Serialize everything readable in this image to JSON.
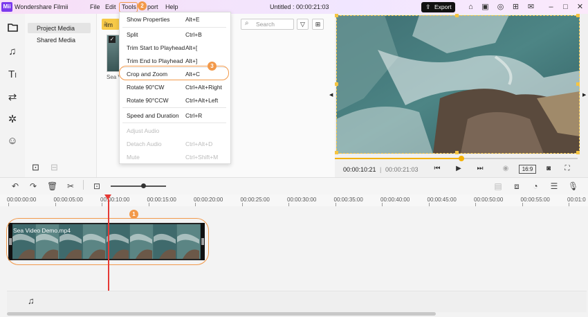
{
  "app": {
    "logo": "Mii",
    "name": "Wondershare Filmii"
  },
  "menubar": [
    "File",
    "Edit",
    "Tools",
    "Export",
    "Help"
  ],
  "menubar_visible": {
    "file": "File",
    "edit": "Edit",
    "tools": "Tools",
    "export_partial": "port",
    "help": "Help"
  },
  "doc_title": "Untitled :  00:00:21:03",
  "export_button": "Export",
  "export_icon": "export-icon",
  "title_icons": [
    "home-icon",
    "save-icon",
    "account-icon",
    "gift-icon",
    "minimize-icon",
    "maximize-icon",
    "close-icon"
  ],
  "left_rail": [
    "media-folder-icon",
    "audio-icon",
    "text-icon",
    "transition-icon",
    "effects-icon",
    "sticker-icon"
  ],
  "media_categories": {
    "project": "Project Media",
    "shared": "Shared Media"
  },
  "media_panel": {
    "import_label": "Im",
    "thumb_label": "Sea V",
    "search_placeholder": "Search"
  },
  "tools_menu": {
    "items": [
      {
        "label": "Show Properties",
        "shortcut": "Alt+E",
        "enabled": true
      },
      {
        "label": "Split",
        "shortcut": "Ctrl+B",
        "enabled": true
      },
      {
        "label": "Trim Start to Playhead",
        "shortcut": "Alt+[",
        "enabled": true
      },
      {
        "label": "Trim End to Playhead",
        "shortcut": "Alt+]",
        "enabled": true
      },
      {
        "label": "Crop and Zoom",
        "shortcut": "Alt+C",
        "enabled": true
      },
      {
        "label": "Rotate 90°CW",
        "shortcut": "Ctrl+Alt+Right",
        "enabled": true
      },
      {
        "label": "Rotate 90°CCW",
        "shortcut": "Ctrl+Alt+Left",
        "enabled": true
      },
      {
        "label": "Speed and Duration",
        "shortcut": "Ctrl+R",
        "enabled": true
      },
      {
        "label": "Adjust Audio",
        "shortcut": "",
        "enabled": false
      },
      {
        "label": "Detach Audio",
        "shortcut": "Ctrl+Alt+D",
        "enabled": false
      },
      {
        "label": "Mute",
        "shortcut": "Ctrl+Shift+M",
        "enabled": false
      }
    ]
  },
  "step_badges": {
    "timeline_clip": "1",
    "tools_menu": "2",
    "crop_and_zoom": "3"
  },
  "preview": {
    "current_time": "00:00:10:21",
    "separator": "|",
    "total_time": "00:00:21:03",
    "progress": 0.52,
    "aspect_ratio": "16:9"
  },
  "timeline": {
    "ruler": [
      "00:00:00:00",
      "00:00:05:00",
      "00:00:10:00",
      "00:00:15:00",
      "00:00:20:00",
      "00:00:25:00",
      "00:00:30:00",
      "00:00:35:00",
      "00:00:40:00",
      "00:00:45:00",
      "00:00:50:00",
      "00:00:55:00",
      "00:01:0"
    ],
    "clip_name": "Sea Video Demo.mp4",
    "zoom_level": 0.55
  },
  "colors": {
    "accent": "#f2994a",
    "playhead": "#e53935",
    "progress": "#f5b000",
    "brand": "#7c3aed"
  }
}
